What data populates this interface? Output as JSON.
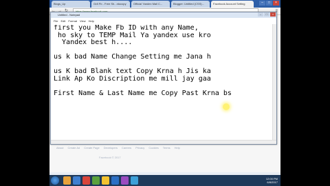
{
  "browser": {
    "tabs": [
      {
        "label": "Blogs_Up",
        "color": "#c9d7ea"
      },
      {
        "label": "Gr8 Fb - Free Sh...ntocopy",
        "color": "#c9d7ea"
      },
      {
        "label": "Official Yandex Mail C...",
        "color": "#c9d7ea"
      },
      {
        "label": "Blogger: Untitled (CSS)...",
        "color": "#c9d7ea"
      },
      {
        "label": "Facebook Account Setting",
        "color": "#f2f2f2"
      }
    ],
    "address": "https://www.facebook.com"
  },
  "notepad": {
    "title": "Untitled - Notepad",
    "menu": [
      "File",
      "Edit",
      "Format",
      "View",
      "Help"
    ],
    "lines": [
      "first you Make Fb ID with any Name,",
      " ho sky to TEMP Mail Ya yandex use kro",
      "  Yandex best h....",
      "",
      "us k bad Name Change Setting me Jana h",
      "",
      "us K bad Blank text Copy Krna h Jis ka",
      "Link Ap Ko Discription me mill jay gaa",
      "",
      "First Name & Last Name me Copy Past Krna bs"
    ]
  },
  "page": {
    "tabs": [
      "About",
      "Create Ad",
      "Create Page",
      "Developers",
      "Careers",
      "Privacy",
      "Cookies",
      "Terms",
      "Help"
    ],
    "footer": "Facebook © 2017"
  },
  "taskbar": {
    "time": "12:00 PM",
    "date": "6/8/2017",
    "icon_colors": [
      "#e7a23a",
      "#3f7fd0",
      "#d9453b",
      "#5aa13c",
      "#f2c230",
      "#2b6fc4",
      "#9a4cc0",
      "#3da0d8"
    ]
  }
}
